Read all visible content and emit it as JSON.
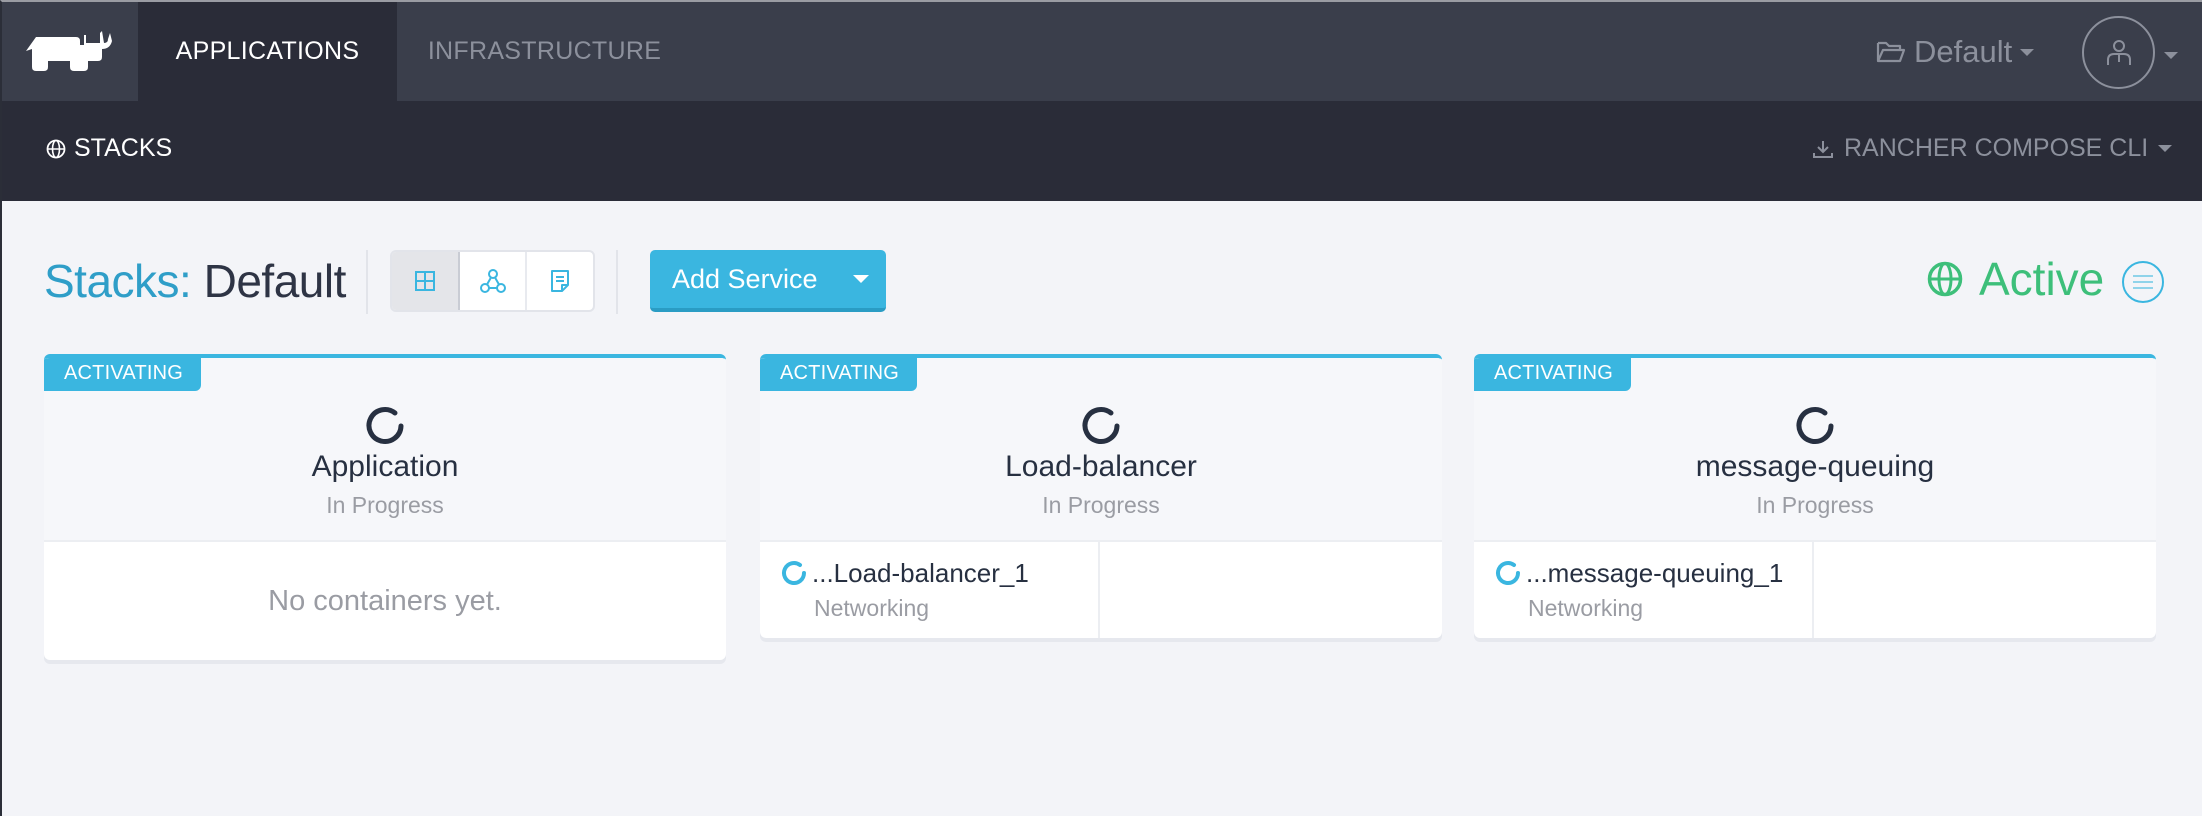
{
  "topnav": {
    "logo": "rancher-logo",
    "tabs": [
      {
        "label": "APPLICATIONS",
        "active": true
      },
      {
        "label": "INFRASTRUCTURE",
        "active": false
      }
    ],
    "environment": {
      "label": "Default",
      "icon": "folder-open-icon"
    },
    "user": {
      "icon": "user-icon"
    }
  },
  "subnav": {
    "stacks": {
      "label": "STACKS",
      "icon": "globe-icon"
    },
    "compose_cli": {
      "label": "RANCHER COMPOSE CLI",
      "icon": "download-icon"
    }
  },
  "header": {
    "title_prefix": "Stacks:",
    "title_name": "Default",
    "views": [
      {
        "name": "grid-view",
        "active": true
      },
      {
        "name": "graph-view",
        "active": false
      },
      {
        "name": "compose-view",
        "active": false
      }
    ],
    "add_service_label": "Add Service",
    "state_label": "Active",
    "colors": {
      "accent": "#3ab6e0",
      "active": "#3dbf7a",
      "title_prefix": "#2f9ec8"
    }
  },
  "cards": [
    {
      "badge": "ACTIVATING",
      "name": "Application",
      "status": "In Progress",
      "empty_text": "No containers yet.",
      "containers": []
    },
    {
      "badge": "ACTIVATING",
      "name": "Load-balancer",
      "status": "In Progress",
      "containers": [
        {
          "name": "...Load-balancer_1",
          "type": "Networking"
        }
      ]
    },
    {
      "badge": "ACTIVATING",
      "name": "message-queuing",
      "status": "In Progress",
      "containers": [
        {
          "name": "...message-queuing_1",
          "type": "Networking"
        }
      ]
    }
  ]
}
